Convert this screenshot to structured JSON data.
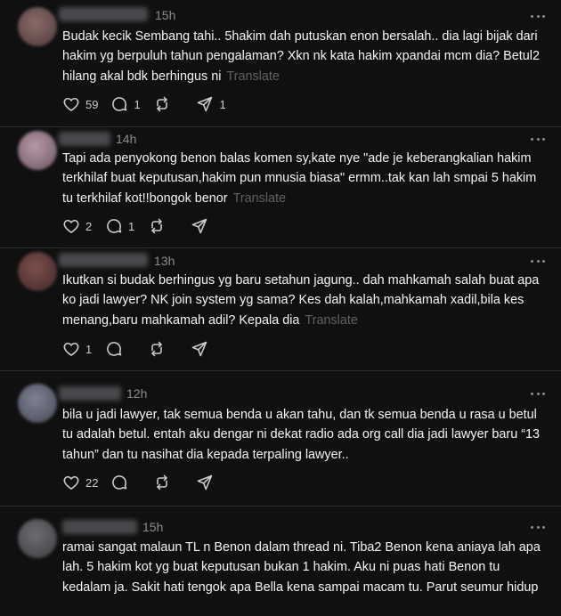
{
  "posts": [
    {
      "time": "15h",
      "text": "Budak kecik Sembang tahi.. 5hakim dah putuskan enon bersalah.. dia lagi bijak dari hakim yg berpuluh tahun pengalaman? Xkn nk kata hakim xpandai mcm dia? Betul2 hilang akal bdk berhingus ni",
      "translate": "Translate",
      "likes": "59",
      "replies": "1",
      "reposts": "",
      "shares": "1"
    },
    {
      "time": "14h",
      "text": "Tapi ada penyokong benon balas komen sy,kate nye \"ade je keberangkalian hakim terkhilaf buat keputusan,hakim pun mnusia biasa\" ermm..tak kan lah smpai 5 hakim tu terkhilaf kot!!bongok benor",
      "translate": "Translate",
      "likes": "2",
      "replies": "1",
      "reposts": "",
      "shares": ""
    },
    {
      "time": "13h",
      "text": "Ikutkan si budak berhingus yg baru setahun jagung.. dah mahkamah salah buat apa ko jadi lawyer? NK join system yg sama? Kes dah kalah,mahkamah xadil,bila kes menang,baru mahkamah adil? Kepala dia",
      "translate": "Translate",
      "likes": "1",
      "replies": "",
      "reposts": "",
      "shares": ""
    },
    {
      "time": "12h",
      "text": "bila u jadi lawyer, tak semua benda u akan tahu, dan tk semua benda u rasa u betul tu adalah betul. entah aku dengar ni dekat radio ada org call dia jadi lawyer baru “13 tahun” dan tu nasihat dia kepada terpaling lawyer..",
      "translate": "",
      "likes": "22",
      "replies": "",
      "reposts": "",
      "shares": ""
    },
    {
      "time": "15h",
      "text": "ramai sangat malaun TL n Benon dalam thread ni. Tiba2 Benon kena aniaya lah apa lah. 5 hakim kot yg buat keputusan bukan 1 hakim. Aku ni puas hati Benon tu kedalam ja. Sakit hati tengok apa Bella kena sampai macam tu. Parut seumur hidup",
      "translate": "",
      "likes": "",
      "replies": "",
      "reposts": "",
      "shares": ""
    }
  ],
  "colors": {
    "background": "#101010",
    "text": "#f3f5f7",
    "muted": "#8c8c8c",
    "translate": "#616161",
    "divider": "#2d2d2d"
  },
  "icons": [
    "heart-icon",
    "comment-icon",
    "repost-icon",
    "share-icon",
    "more-icon"
  ]
}
